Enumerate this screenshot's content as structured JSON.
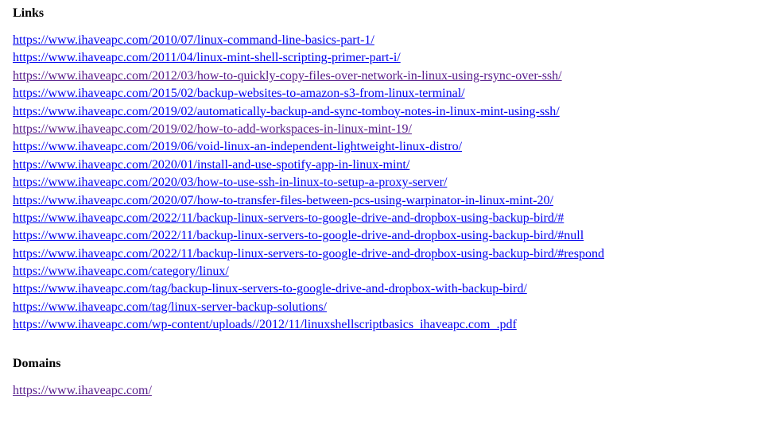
{
  "sections": {
    "links": {
      "heading": "Links",
      "items": [
        {
          "url": "https://www.ihaveapc.com/2010/07/linux-command-line-basics-part-1/",
          "visited": false
        },
        {
          "url": "https://www.ihaveapc.com/2011/04/linux-mint-shell-scripting-primer-part-i/",
          "visited": false
        },
        {
          "url": "https://www.ihaveapc.com/2012/03/how-to-quickly-copy-files-over-network-in-linux-using-rsync-over-ssh/",
          "visited": true
        },
        {
          "url": "https://www.ihaveapc.com/2015/02/backup-websites-to-amazon-s3-from-linux-terminal/",
          "visited": false
        },
        {
          "url": "https://www.ihaveapc.com/2019/02/automatically-backup-and-sync-tomboy-notes-in-linux-mint-using-ssh/",
          "visited": false
        },
        {
          "url": "https://www.ihaveapc.com/2019/02/how-to-add-workspaces-in-linux-mint-19/",
          "visited": true
        },
        {
          "url": "https://www.ihaveapc.com/2019/06/void-linux-an-independent-lightweight-linux-distro/",
          "visited": false
        },
        {
          "url": "https://www.ihaveapc.com/2020/01/install-and-use-spotify-app-in-linux-mint/",
          "visited": false
        },
        {
          "url": "https://www.ihaveapc.com/2020/03/how-to-use-ssh-in-linux-to-setup-a-proxy-server/",
          "visited": false
        },
        {
          "url": "https://www.ihaveapc.com/2020/07/how-to-transfer-files-between-pcs-using-warpinator-in-linux-mint-20/",
          "visited": false
        },
        {
          "url": "https://www.ihaveapc.com/2022/11/backup-linux-servers-to-google-drive-and-dropbox-using-backup-bird/#",
          "visited": false
        },
        {
          "url": "https://www.ihaveapc.com/2022/11/backup-linux-servers-to-google-drive-and-dropbox-using-backup-bird/#null",
          "visited": false
        },
        {
          "url": "https://www.ihaveapc.com/2022/11/backup-linux-servers-to-google-drive-and-dropbox-using-backup-bird/#respond",
          "visited": false
        },
        {
          "url": "https://www.ihaveapc.com/category/linux/",
          "visited": false
        },
        {
          "url": "https://www.ihaveapc.com/tag/backup-linux-servers-to-google-drive-and-dropbox-with-backup-bird/",
          "visited": false
        },
        {
          "url": "https://www.ihaveapc.com/tag/linux-server-backup-solutions/",
          "visited": false
        },
        {
          "url": "https://www.ihaveapc.com/wp-content/uploads//2012/11/linuxshellscriptbasics_ihaveapc.com_.pdf",
          "visited": false
        }
      ]
    },
    "domains": {
      "heading": "Domains",
      "items": [
        {
          "url": "https://www.ihaveapc.com/",
          "visited": true
        }
      ]
    }
  }
}
